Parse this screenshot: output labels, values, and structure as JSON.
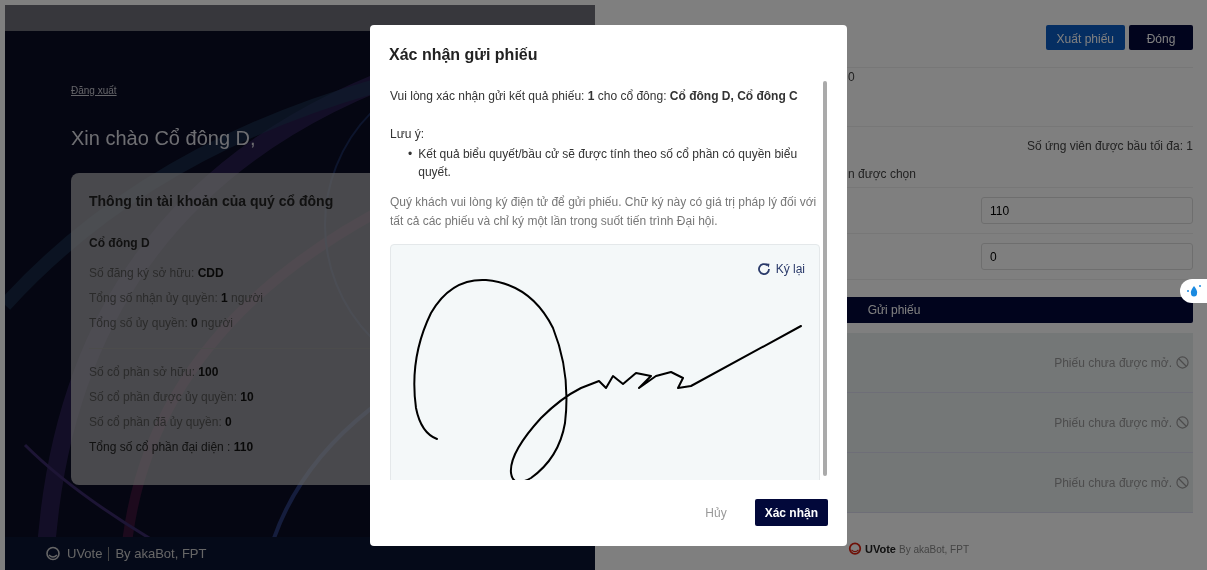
{
  "left_panel": {
    "logout_link": "Đăng xuất",
    "greeting": "Xin chào Cổ đông D,",
    "account_card": {
      "title": "Thông tin tài khoản của quý cổ đông",
      "name": "Cổ đông D",
      "groups": [
        [
          {
            "label": "Số đăng ký sở hữu:",
            "value": "CDD"
          },
          {
            "label": "Tổng số nhận ủy quyền:",
            "value": "1",
            "unit": "người"
          },
          {
            "label": "Tổng số ủy quyền:",
            "value": "0",
            "unit": "người"
          }
        ],
        [
          {
            "label": "Số cổ phần sở hữu:",
            "value": "100"
          },
          {
            "label": "Số cổ phần được ủy quyền:",
            "value": "10"
          },
          {
            "label": "Số cổ phần đã ủy quyền:",
            "value": "0"
          },
          {
            "label": "Tổng số cổ phần đại diện :",
            "value": "110",
            "kind": "total"
          }
        ]
      ]
    },
    "footer": {
      "brand": "UVote",
      "credit": "By akaBot, FPT"
    }
  },
  "right_panel": {
    "buttons": [
      {
        "label": "Xuất phiếu",
        "kind": "primary"
      },
      {
        "label": "Đóng",
        "kind": "dark"
      }
    ],
    "partial_value": "0",
    "max_candidates": "Số ứng viên được bầu tối đa: 1",
    "partial_label": "n được chọn",
    "inputs": [
      {
        "value": "110"
      },
      {
        "value": "0"
      }
    ],
    "submit_button": "Gửi phiếu",
    "ballots": [
      {
        "status": "Phiếu chưa được mở."
      },
      {
        "status": "Phiếu chưa được mở."
      },
      {
        "status": "Phiếu chưa được mở."
      }
    ],
    "footer": {
      "brand": "UVote",
      "credit": "By akaBot, FPT"
    }
  },
  "modal": {
    "title": "Xác nhận gửi phiếu",
    "message": "Vui lòng xác nhận gửi kết quả phiếu: **1** cho cổ đông: **Cổ đông D, Cổ đông C**",
    "note_label": "Lưu ý:",
    "notes": [
      {
        "marker": "•",
        "text": "Kết quả biểu quyết/bầu cử sẽ được tính theo số cổ phần có quyền biểu quyết."
      }
    ],
    "instruction": "Quý khách vui lòng ký điện tử để gửi phiếu. Chữ ký này có giá trị pháp lý đối với tất cả các phiếu và chỉ ký một lần trong suốt tiến trình Đại hội.",
    "resign_button": "Ký lại",
    "buttons": [
      {
        "label": "Hủy",
        "kind": "cancel"
      },
      {
        "label": "Xác nhận",
        "kind": "primary"
      }
    ]
  }
}
